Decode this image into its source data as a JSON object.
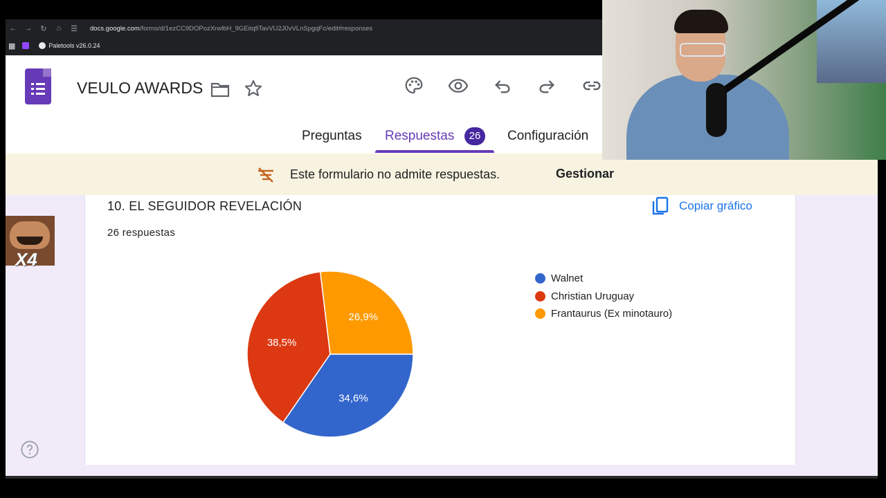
{
  "browser": {
    "url_host": "docs.google.com",
    "url_path": "/forms/d/1ezCC9DOPozXrwlbH_9GEitqfiTavVU2J0vVLnSpgqFc/edit#responses",
    "bookmark": "Paletools v26.0.24"
  },
  "form": {
    "title": "VEULO AWARDS"
  },
  "tabs": {
    "questions": "Preguntas",
    "responses": "Respuestas",
    "responses_count": "26",
    "settings": "Configuración"
  },
  "banner": {
    "text": "Este formulario no admite respuestas.",
    "manage": "Gestionar"
  },
  "question": {
    "title": "10. EL SEGUIDOR REVELACIÓN",
    "count": "26 respuestas",
    "copy_chart": "Copiar gráfico"
  },
  "sticker": {
    "text": "X4"
  },
  "chart_data": {
    "type": "pie",
    "slices": [
      {
        "label": "Walnet",
        "value": 34.6,
        "display": "34,6%",
        "color": "#3366cc"
      },
      {
        "label": "Christian Uruguay",
        "value": 38.5,
        "display": "38,5%",
        "color": "#dc3912"
      },
      {
        "label": "Frantaurus (Ex minotauro)",
        "value": 26.9,
        "display": "26,9%",
        "color": "#ff9900"
      }
    ]
  }
}
